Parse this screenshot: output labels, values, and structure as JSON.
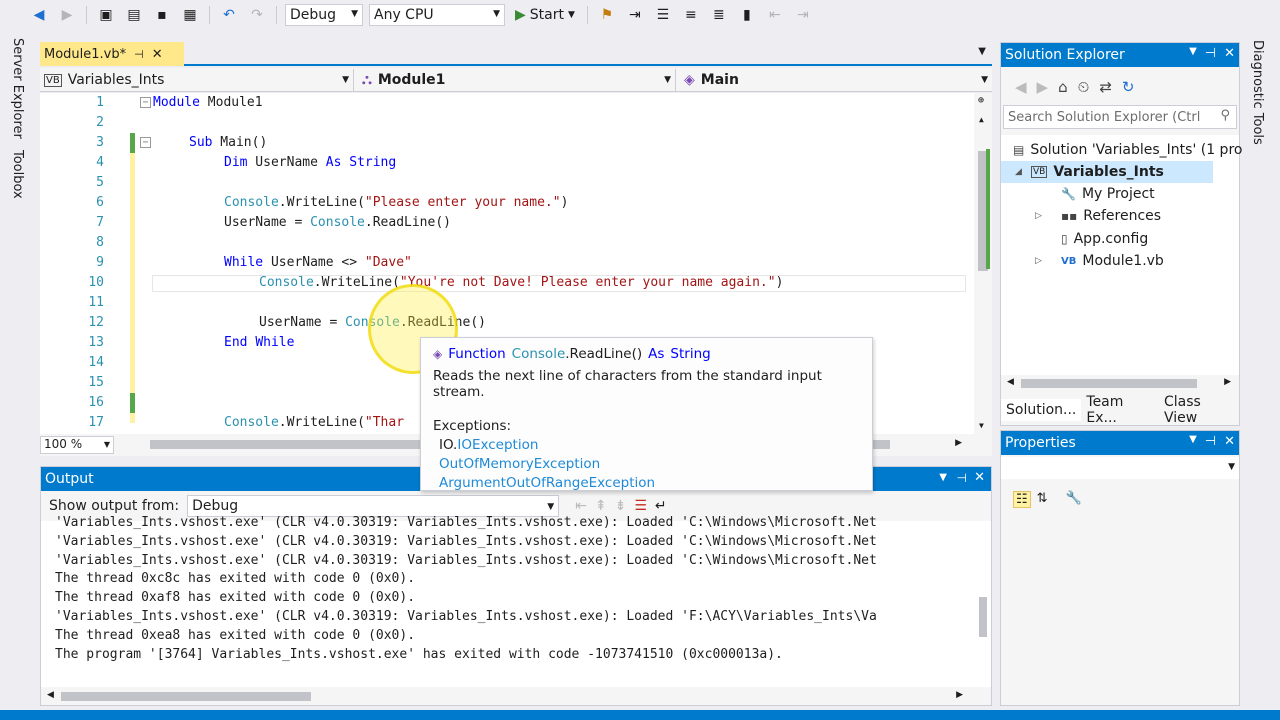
{
  "toolbar": {
    "config": "Debug",
    "platform": "Any CPU",
    "start_label": "Start"
  },
  "left_rail": {
    "server_explorer": "Server Explorer",
    "toolbox": "Toolbox"
  },
  "right_rail": {
    "diagnostic_tools": "Diagnostic Tools"
  },
  "document_tab": {
    "title": "Module1.vb*"
  },
  "nav_bar": {
    "project": "Variables_Ints",
    "type": "Module1",
    "member": "Main"
  },
  "editor": {
    "zoom": "100 %",
    "line_numbers": [
      "1",
      "2",
      "3",
      "4",
      "5",
      "6",
      "7",
      "8",
      "9",
      "10",
      "11",
      "12",
      "13",
      "14",
      "15",
      "16",
      "17"
    ]
  },
  "tooltip": {
    "kind": "Function",
    "type_name": "Console",
    "method": ".ReadLine()",
    "as_kw": "As",
    "return_type": "String",
    "description": "Reads the next line of characters from the standard input stream.",
    "exceptions_label": "Exceptions:",
    "ex1_ns": "IO.",
    "ex1_name": "IOException",
    "ex2": "OutOfMemoryException",
    "ex3": "ArgumentOutOfRangeException"
  },
  "output": {
    "title": "Output",
    "show_from_label": "Show output from:",
    "source": "Debug",
    "lines": [
      "'Variables_Ints.vshost.exe' (CLR v4.0.30319: Variables_Ints.vshost.exe): Loaded 'C:\\Windows\\Microsoft.Net",
      "'Variables_Ints.vshost.exe' (CLR v4.0.30319: Variables_Ints.vshost.exe): Loaded 'C:\\Windows\\Microsoft.Net",
      "'Variables_Ints.vshost.exe' (CLR v4.0.30319: Variables_Ints.vshost.exe): Loaded 'C:\\Windows\\Microsoft.Net",
      "The thread 0xc8c has exited with code 0 (0x0).",
      "The thread 0xaf8 has exited with code 0 (0x0).",
      "'Variables_Ints.vshost.exe' (CLR v4.0.30319: Variables_Ints.vshost.exe): Loaded 'F:\\ACY\\Variables_Ints\\Va",
      "The thread 0xea8 has exited with code 0 (0x0).",
      "The program '[3764] Variables_Ints.vshost.exe' has exited with code -1073741510 (0xc000013a)."
    ]
  },
  "solution_explorer": {
    "title": "Solution Explorer",
    "search_placeholder": "Search Solution Explorer (Ctrl",
    "solution": "Solution 'Variables_Ints' (1 pro",
    "project": "Variables_Ints",
    "my_project": "My Project",
    "references": "References",
    "app_config": "App.config",
    "module": "Module1.vb",
    "tabs": [
      "Solution...",
      "Team Ex...",
      "Class View"
    ]
  },
  "properties": {
    "title": "Properties"
  },
  "colors": {
    "accent": "#007acc",
    "keyword": "#0000ff",
    "string": "#a31515",
    "type": "#2b91af",
    "tab_active": "#ffe88a"
  }
}
